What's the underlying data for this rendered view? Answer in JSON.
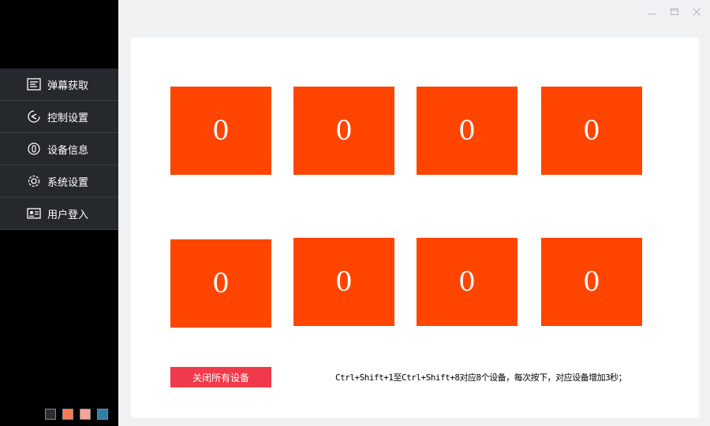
{
  "sidebar": {
    "items": [
      {
        "label": "弹幕获取",
        "icon": "list-icon"
      },
      {
        "label": "控制设置",
        "icon": "control-icon"
      },
      {
        "label": "设备信息",
        "icon": "device-icon"
      },
      {
        "label": "系统设置",
        "icon": "gear-icon"
      },
      {
        "label": "用户登入",
        "icon": "id-card-icon"
      }
    ],
    "theme_swatches": [
      "#2b2e33",
      "#f87a55",
      "#f5a39a",
      "#2f7ea8"
    ]
  },
  "tiles": [
    "0",
    "0",
    "0",
    "0",
    "0",
    "0",
    "0",
    "0"
  ],
  "close_all_label": "关闭所有设备",
  "hint_text": "Ctrl+Shift+1至Ctrl+Shift+8对应8个设备，每次按下，对应设备增加3秒；",
  "colors": {
    "tile": "#ff4500",
    "close_button": "#f0394a",
    "sidebar": "#000000",
    "nav_item": "#25282c"
  }
}
